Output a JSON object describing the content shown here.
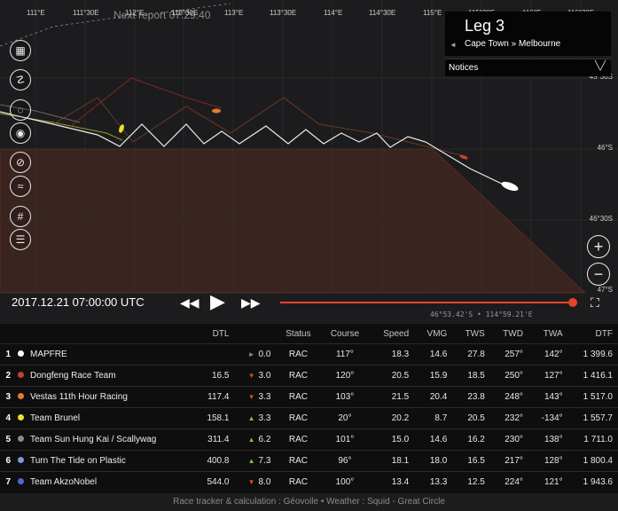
{
  "map": {
    "next_report": "Next report 07:29:40",
    "longitude_labels": [
      "111°E",
      "111°30E",
      "112°E",
      "112°30E",
      "113°E",
      "113°30E",
      "114°E",
      "114°30E",
      "115°E",
      "115°30E",
      "116°E",
      "116°30E"
    ],
    "latitude_labels": [
      "45°30S",
      "46°S",
      "46°30S",
      "47°S"
    ],
    "tools": [
      "map-icon",
      "route-icon",
      "zoom-course-icon",
      "boat-focus-icon",
      "compass-icon",
      "wind-icon",
      "grid-icon",
      "layers-icon"
    ],
    "zoom_in": "+",
    "zoom_out": "−"
  },
  "leg": {
    "title": "Leg 3",
    "route": "Cape Town » Melbourne",
    "notices_label": "Notices"
  },
  "playback": {
    "date": "2017.12.21 07:00:00 UTC",
    "coords": "46°53.42'S • 114°59.21'E",
    "progress": 1.0
  },
  "table": {
    "headers": {
      "dtl": "DTL",
      "status": "Status",
      "course": "Course",
      "speed": "Speed",
      "vmg": "VMG",
      "tws": "TWS",
      "twd": "TWD",
      "twa": "TWA",
      "dtf": "DTF"
    },
    "rows": [
      {
        "rank": "1",
        "team": "MAPFRE",
        "color": "#ffffff",
        "dtl": "",
        "trend": "►",
        "trend_color": "#8a8a8a",
        "change": "0.0",
        "status": "RAC",
        "course": "117°",
        "speed": "18.3",
        "vmg": "14.6",
        "tws": "27.8",
        "twd": "257°",
        "twa": "142°",
        "dtf": "1 399.6"
      },
      {
        "rank": "2",
        "team": "Dongfeng Race Team",
        "color": "#c4402e",
        "dtl": "16.5",
        "trend": "▼",
        "trend_color": "#e0442a",
        "change": "3.0",
        "status": "RAC",
        "course": "120°",
        "speed": "20.5",
        "vmg": "15.9",
        "tws": "18.5",
        "twd": "250°",
        "twa": "127°",
        "dtf": "1 416.1"
      },
      {
        "rank": "3",
        "team": "Vestas 11th Hour Racing",
        "color": "#e57a2e",
        "dtl": "117.4",
        "trend": "▼",
        "trend_color": "#e0442a",
        "change": "3.3",
        "status": "RAC",
        "course": "103°",
        "speed": "21.5",
        "vmg": "20.4",
        "tws": "23.8",
        "twd": "248°",
        "twa": "143°",
        "dtf": "1 517.0"
      },
      {
        "rank": "4",
        "team": "Team Brunel",
        "color": "#f0e02a",
        "dtl": "158.1",
        "trend": "▲",
        "trend_color": "#7cc242",
        "change": "3.3",
        "status": "RAC",
        "course": "20°",
        "speed": "20.2",
        "vmg": "8.7",
        "tws": "20.5",
        "twd": "232°",
        "twa": "-134°",
        "dtf": "1 557.7"
      },
      {
        "rank": "5",
        "team": "Team Sun Hung Kai / Scallywag",
        "color": "#8a8a8a",
        "dtl": "311.4",
        "trend": "▲",
        "trend_color": "#7cc242",
        "change": "6.2",
        "status": "RAC",
        "course": "101°",
        "speed": "15.0",
        "vmg": "14.6",
        "tws": "16.2",
        "twd": "230°",
        "twa": "138°",
        "dtf": "1 711.0"
      },
      {
        "rank": "6",
        "team": "Turn The Tide on Plastic",
        "color": "#7a9ad8",
        "dtl": "400.8",
        "trend": "▲",
        "trend_color": "#7cc242",
        "change": "7.3",
        "status": "RAC",
        "course": "96°",
        "speed": "18.1",
        "vmg": "18.0",
        "tws": "16.5",
        "twd": "217°",
        "twa": "128°",
        "dtf": "1 800.4"
      },
      {
        "rank": "7",
        "team": "Team AkzoNobel",
        "color": "#4a6ad8",
        "dtl": "544.0",
        "trend": "▼",
        "trend_color": "#e0442a",
        "change": "8.0",
        "status": "RAC",
        "course": "100°",
        "speed": "13.4",
        "vmg": "13.3",
        "tws": "12.5",
        "twd": "224°",
        "twa": "121°",
        "dtf": "1 943.6"
      }
    ]
  },
  "footer": "Race tracker & calculation : Géovoile • Weather : Squid - Great Circle"
}
